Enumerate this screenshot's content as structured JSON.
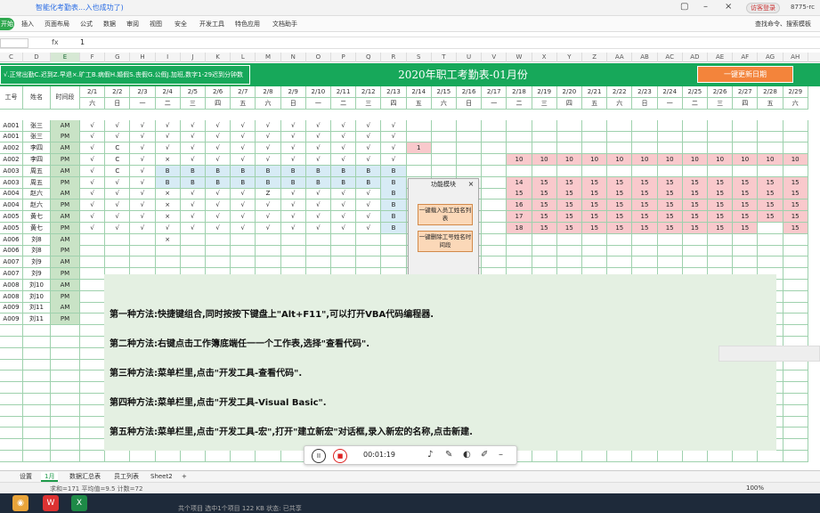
{
  "titlebar": {
    "doc_title": "智能化考勤表...入也成功了)",
    "tag": "访客登录",
    "user": "8775-rc"
  },
  "menubar": {
    "start_label": "开始",
    "items": [
      "插入",
      "页面布局",
      "公式",
      "数据",
      "审阅",
      "视图",
      "安全",
      "开发工具",
      "特色应用",
      "文档助手"
    ],
    "search_label": "查找命令、搜索模板"
  },
  "formulabar": {
    "fx_label": "fx",
    "value": "1"
  },
  "columns": [
    "C",
    "D",
    "E",
    "F",
    "G",
    "H",
    "I",
    "J",
    "K",
    "L",
    "M",
    "N",
    "O",
    "P",
    "Q",
    "R",
    "S",
    "T",
    "U",
    "V",
    "W",
    "X",
    "Y",
    "Z",
    "AA",
    "AB",
    "AC",
    "AD",
    "AE",
    "AF",
    "AG",
    "AH"
  ],
  "banner": {
    "legend": "√.正常出勤C.迟到Z.早退×.旷工B.病假H.婚假S.丧假G.公假J.加班,数字1-29迟到分钟数",
    "title": "2020年职工考勤表-01月份",
    "update_button": "一键更新日期"
  },
  "sheet": {
    "hdr_id": "工号",
    "hdr_name": "姓名",
    "hdr_period": "时间段",
    "dates": [
      "2/1",
      "2/2",
      "2/3",
      "2/4",
      "2/5",
      "2/6",
      "2/7",
      "2/8",
      "2/9",
      "2/10",
      "2/11",
      "2/12",
      "2/13",
      "2/14",
      "2/15",
      "2/16",
      "2/17",
      "2/18",
      "2/19",
      "2/20",
      "2/21",
      "2/22",
      "2/23",
      "2/24",
      "2/25",
      "2/26",
      "2/27",
      "2/28",
      "2/29"
    ],
    "weekdays": [
      "六",
      "日",
      "一",
      "二",
      "三",
      "四",
      "五",
      "六",
      "日",
      "一",
      "二",
      "三",
      "四",
      "五",
      "六",
      "日",
      "一",
      "二",
      "三",
      "四",
      "五",
      "六",
      "日",
      "一",
      "二",
      "三",
      "四",
      "五",
      "六"
    ],
    "rows": [
      {
        "id": "A001",
        "name": "张三",
        "period": "AM",
        "marks": [
          "√",
          "√",
          "√",
          "√",
          "√",
          "√",
          "√",
          "√",
          "√",
          "√",
          "√",
          "√",
          "√",
          "",
          "",
          "",
          "",
          "",
          "",
          "",
          "",
          "",
          "",
          "",
          "",
          "",
          "",
          "",
          ""
        ]
      },
      {
        "id": "A001",
        "name": "张三",
        "period": "PM",
        "marks": [
          "√",
          "√",
          "√",
          "√",
          "√",
          "√",
          "√",
          "√",
          "√",
          "√",
          "√",
          "√",
          "√",
          "",
          "",
          "",
          "",
          "",
          "",
          "",
          "",
          "",
          "",
          "",
          "",
          "",
          "",
          "",
          ""
        ]
      },
      {
        "id": "A002",
        "name": "李四",
        "period": "AM",
        "marks": [
          "√",
          "C",
          "√",
          "√",
          "√",
          "√",
          "√",
          "√",
          "√",
          "√",
          "√",
          "√",
          "√",
          "1",
          "",
          "",
          "",
          "",
          "",
          "",
          "",
          "",
          "",
          "",
          "",
          "",
          "",
          "",
          ""
        ]
      },
      {
        "id": "A002",
        "name": "李四",
        "period": "PM",
        "marks": [
          "√",
          "C",
          "√",
          "×",
          "√",
          "√",
          "√",
          "√",
          "√",
          "√",
          "√",
          "√",
          "√",
          "",
          "",
          "",
          "",
          "10",
          "10",
          "10",
          "10",
          "10",
          "10",
          "10",
          "10",
          "10",
          "10",
          "10",
          "10"
        ]
      },
      {
        "id": "A003",
        "name": "周五",
        "period": "AM",
        "marks": [
          "√",
          "C",
          "√",
          "B",
          "B",
          "B",
          "B",
          "B",
          "B",
          "B",
          "B",
          "B",
          "B",
          "",
          "",
          "",
          "",
          "",
          "",
          "",
          "",
          "",
          "",
          "",
          "",
          "",
          "",
          "",
          ""
        ]
      },
      {
        "id": "A003",
        "name": "周五",
        "period": "PM",
        "marks": [
          "√",
          "√",
          "√",
          "B",
          "B",
          "B",
          "B",
          "B",
          "B",
          "B",
          "B",
          "B",
          "B",
          "",
          "",
          "",
          "",
          "14",
          "15",
          "15",
          "15",
          "15",
          "15",
          "15",
          "15",
          "15",
          "15",
          "15",
          "15"
        ]
      },
      {
        "id": "A004",
        "name": "赵六",
        "period": "AM",
        "marks": [
          "√",
          "√",
          "√",
          "×",
          "√",
          "√",
          "√",
          "Z",
          "√",
          "√",
          "√",
          "√",
          "B",
          "",
          "",
          "",
          "",
          "15",
          "15",
          "15",
          "15",
          "15",
          "15",
          "15",
          "15",
          "15",
          "15",
          "15",
          "15"
        ]
      },
      {
        "id": "A004",
        "name": "赵六",
        "period": "PM",
        "marks": [
          "√",
          "√",
          "√",
          "×",
          "√",
          "√",
          "√",
          "√",
          "√",
          "√",
          "√",
          "√",
          "B",
          "",
          "",
          "",
          "",
          "16",
          "15",
          "15",
          "15",
          "15",
          "15",
          "15",
          "15",
          "15",
          "15",
          "15",
          "15"
        ]
      },
      {
        "id": "A005",
        "name": "黄七",
        "period": "AM",
        "marks": [
          "√",
          "√",
          "√",
          "×",
          "√",
          "√",
          "√",
          "√",
          "√",
          "√",
          "√",
          "√",
          "B",
          "",
          "",
          "",
          "",
          "17",
          "15",
          "15",
          "15",
          "15",
          "15",
          "15",
          "15",
          "15",
          "15",
          "15",
          "15"
        ]
      },
      {
        "id": "A005",
        "name": "黄七",
        "period": "PM",
        "marks": [
          "√",
          "√",
          "√",
          "√",
          "√",
          "√",
          "√",
          "√",
          "√",
          "√",
          "√",
          "√",
          "B",
          "",
          "",
          "",
          "",
          "18",
          "15",
          "15",
          "15",
          "15",
          "15",
          "15",
          "15",
          "15",
          "15",
          "",
          "15"
        ]
      },
      {
        "id": "A006",
        "name": "刘8",
        "period": "AM",
        "marks": [
          "",
          "",
          "",
          "×",
          "",
          "",
          "",
          "",
          "",
          "",
          "",
          "",
          "",
          "",
          "",
          "",
          "",
          "",
          "",
          "",
          "",
          "",
          "",
          "",
          "",
          "",
          "",
          "",
          ""
        ]
      },
      {
        "id": "A006",
        "name": "刘8",
        "period": "PM",
        "marks": []
      },
      {
        "id": "A007",
        "name": "刘9",
        "period": "AM",
        "marks": []
      },
      {
        "id": "A007",
        "name": "刘9",
        "period": "PM",
        "marks": []
      },
      {
        "id": "A008",
        "name": "刘10",
        "period": "AM",
        "marks": []
      },
      {
        "id": "A008",
        "name": "刘10",
        "period": "PM",
        "marks": []
      },
      {
        "id": "A009",
        "name": "刘11",
        "period": "AM",
        "marks": []
      },
      {
        "id": "A009",
        "name": "刘11",
        "period": "PM",
        "marks": []
      }
    ]
  },
  "panel": {
    "title": "功能模块",
    "close": "×",
    "btn_import": "一键载入员工姓名列表",
    "btn_delete": "一键删除工号姓名时间段"
  },
  "notes": [
    "第一种方法:快捷键组合,同时按按下键盘上\"Alt+F11\",可以打开VBA代码编程器.",
    "第二种方法:右键点击工作簿底端任一一个工作表,选择\"查看代码\".",
    "第三种方法:菜单栏里,点击\"开发工具-查看代码\".",
    "第四种方法:菜单栏里,点击\"开发工具-Visual Basic\".",
    "第五种方法:菜单栏里,点击\"开发工具-宏\",打开\"建立新宏\"对话框,录入新宏的名称,点击新建."
  ],
  "player": {
    "pause": "II",
    "stop": "■",
    "time": "00:01:19"
  },
  "sheettabs": [
    "设置",
    "1月",
    "数据汇总表",
    "员工列表",
    "Sheet2",
    "+"
  ],
  "active_tab": "1月",
  "statusbar": {
    "summary": "求和=171  平均值=9.5  计数=72",
    "zoom": "100%"
  },
  "taskbar": {
    "text": "共个项目  选中1个项目  122 KB   状态: 已共享"
  },
  "colors": {
    "accent": "#17a85a",
    "orange": "#f3843b",
    "pink": "#f9c9cc",
    "blue": "#d7ebf5"
  }
}
